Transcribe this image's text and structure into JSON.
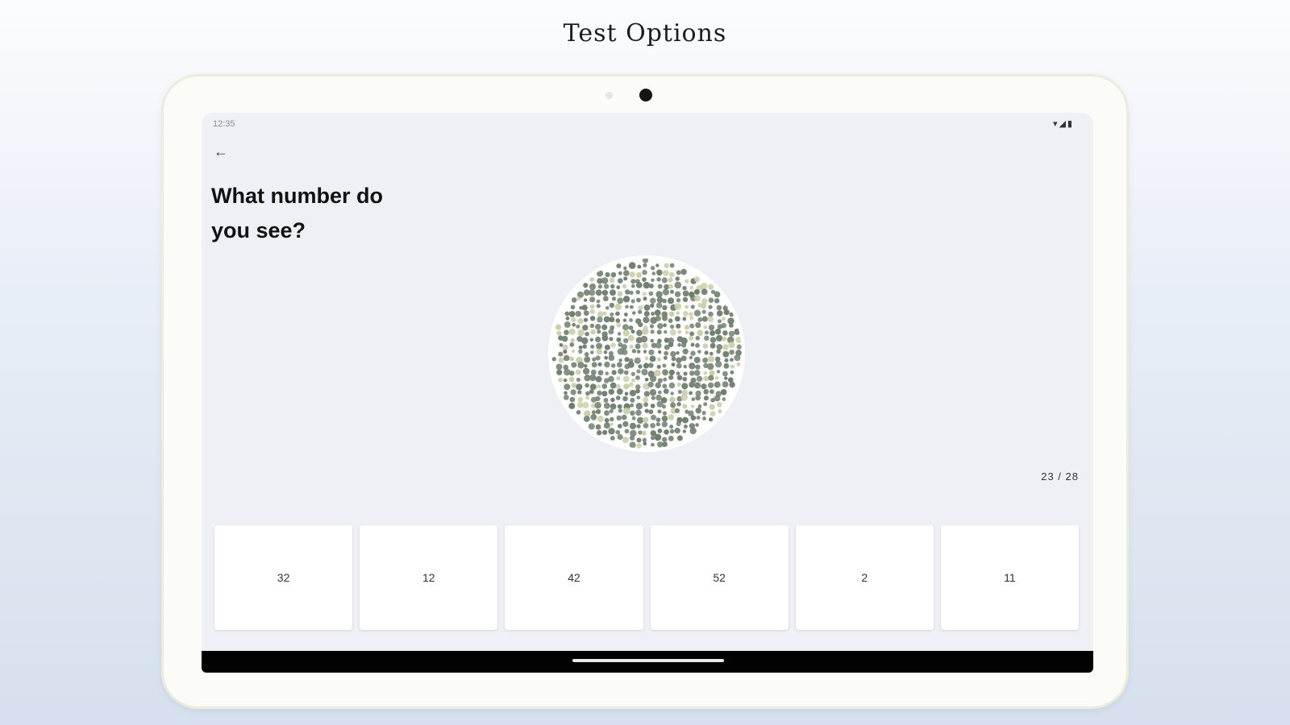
{
  "promo": {
    "title": "Test Options"
  },
  "status_bar": {
    "time": "12:35",
    "icons": "▾◢▮"
  },
  "app": {
    "back_icon": "arrow-left-icon",
    "question": "What number do you see?",
    "plate_number": "12",
    "progress": "23 / 28",
    "options": [
      "32",
      "12",
      "42",
      "52",
      "2",
      "11"
    ]
  },
  "colors": {
    "plate_background_dots": "#6f7f6e",
    "plate_figure_dots": "#e8502c",
    "plate_light_dots": "#c9cfa9"
  }
}
